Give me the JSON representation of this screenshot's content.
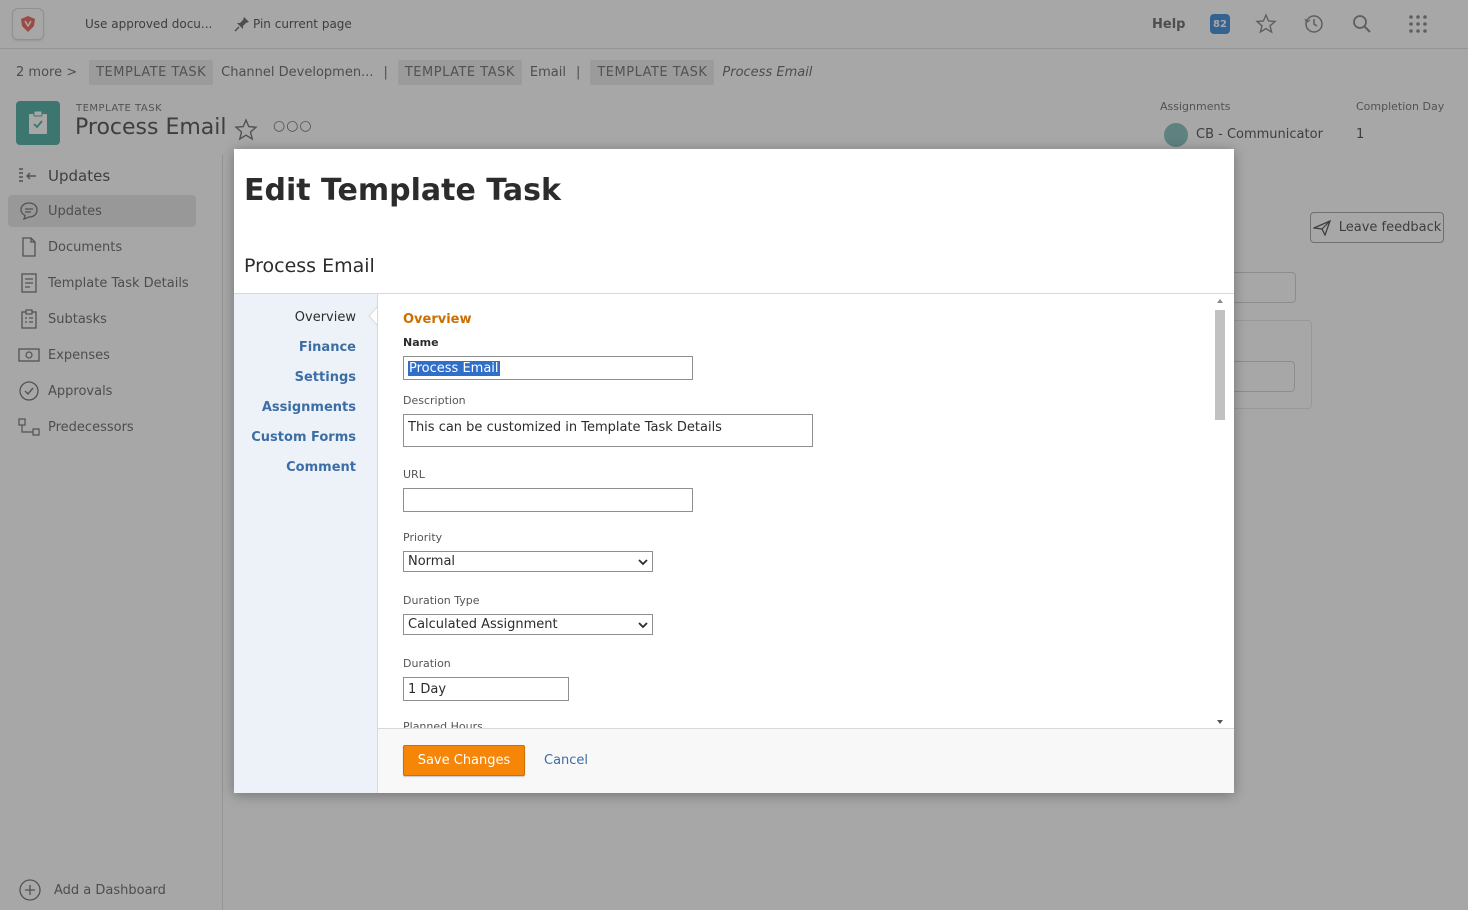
{
  "topbar": {
    "shortcut_1": "Use approved docu...",
    "shortcut_2": "Pin current page",
    "help": "Help",
    "notifications": "82"
  },
  "breadcrumbs": {
    "more": "2 more",
    "items": [
      {
        "type": "TEMPLATE TASK",
        "name": "Channel Developmen..."
      },
      {
        "type": "TEMPLATE TASK",
        "name": "Email"
      },
      {
        "type": "TEMPLATE TASK",
        "name": "Process Email"
      }
    ]
  },
  "header": {
    "object_type": "TEMPLATE TASK",
    "title": "Process Email",
    "assignments_label": "Assignments",
    "assignments_value": "CB - Communicator",
    "completion_label": "Completion Day",
    "completion_value": "1"
  },
  "sidebar": {
    "title": "Updates",
    "items": [
      {
        "label": "Updates",
        "icon": "chat-bubble-icon"
      },
      {
        "label": "Documents",
        "icon": "document-icon"
      },
      {
        "label": "Template Task Details",
        "icon": "details-icon"
      },
      {
        "label": "Subtasks",
        "icon": "subtasks-icon"
      },
      {
        "label": "Expenses",
        "icon": "money-icon"
      },
      {
        "label": "Approvals",
        "icon": "checkmark-circle-icon"
      },
      {
        "label": "Predecessors",
        "icon": "predecessor-icon"
      }
    ],
    "add_dashboard": "Add a Dashboard"
  },
  "feedback": "Leave feedback",
  "modal": {
    "title": "Edit Template Task",
    "subtitle": "Process Email",
    "nav": [
      "Overview",
      "Finance",
      "Settings",
      "Assignments",
      "Custom Forms",
      "Comment"
    ],
    "section": "Overview",
    "fields": {
      "name_label": "Name",
      "name_value": "Process Email",
      "description_label": "Description",
      "description_value": "This can be customized in Template Task Details",
      "url_label": "URL",
      "url_value": "",
      "priority_label": "Priority",
      "priority_value": "Normal",
      "duration_type_label": "Duration Type",
      "duration_type_value": "Calculated Assignment",
      "duration_label": "Duration",
      "duration_value": "1 Day",
      "planned_hours_label": "Planned Hours"
    },
    "save": "Save Changes",
    "cancel": "Cancel"
  },
  "colors": {
    "accent_orange": "#f68608",
    "section_orange": "#cc6f00",
    "link_blue": "#3c6ea5",
    "object_teal": "#2a9d8f"
  }
}
